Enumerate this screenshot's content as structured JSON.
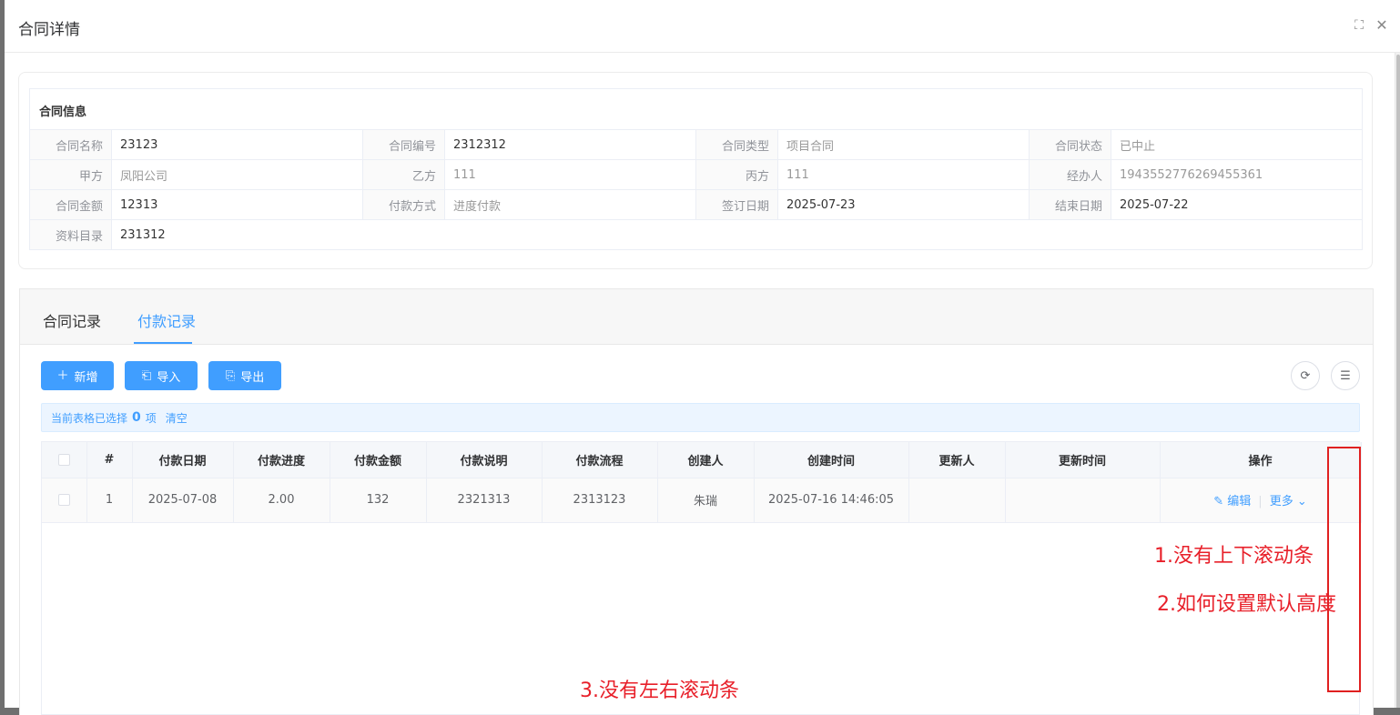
{
  "dialog": {
    "title": "合同详情"
  },
  "info": {
    "section_title": "合同信息",
    "rows": [
      [
        {
          "label": "合同名称",
          "value": "23123"
        },
        {
          "label": "合同编号",
          "value": "2312312"
        },
        {
          "label": "合同类型",
          "value": "项目合同"
        },
        {
          "label": "合同状态",
          "value": "已中止"
        }
      ],
      [
        {
          "label": "甲方",
          "value": "凤阳公司"
        },
        {
          "label": "乙方",
          "value": "111"
        },
        {
          "label": "丙方",
          "value": "111"
        },
        {
          "label": "经办人",
          "value": "1943552776269455361"
        }
      ],
      [
        {
          "label": "合同金额",
          "value": "12313"
        },
        {
          "label": "付款方式",
          "value": "进度付款"
        },
        {
          "label": "签订日期",
          "value": "2025-07-23"
        },
        {
          "label": "结束日期",
          "value": "2025-07-22"
        }
      ],
      [
        {
          "label": "资料目录",
          "value": "231312"
        }
      ]
    ]
  },
  "tabs": [
    {
      "label": "合同记录"
    },
    {
      "label": "付款记录"
    }
  ],
  "active_tab": "付款记录",
  "toolbar": {
    "add_label": "新增",
    "import_label": "导入",
    "export_label": "导出"
  },
  "selection": {
    "prefix": "当前表格已选择",
    "count": "0",
    "unit": "项",
    "clear_label": "清空"
  },
  "table": {
    "columns": [
      "#",
      "付款日期",
      "付款进度",
      "付款金额",
      "付款说明",
      "付款流程",
      "创建人",
      "创建时间",
      "更新人",
      "更新时间",
      "操作"
    ],
    "rows": [
      {
        "index": "1",
        "date": "2025-07-08",
        "progress": "2.00",
        "amount": "132",
        "desc": "2321313",
        "flow": "2313123",
        "creator": "朱瑞",
        "created_at": "2025-07-16 14:46:05",
        "updater": "",
        "updated_at": "",
        "edit_label": "编辑",
        "more_label": "更多"
      }
    ]
  },
  "annotations": {
    "note1": "1.没有上下滚动条",
    "note2": "2.如何设置默认高度",
    "note3": "3.没有左右滚动条",
    "color": "#e8202a"
  },
  "colors": {
    "primary": "#409eff"
  }
}
